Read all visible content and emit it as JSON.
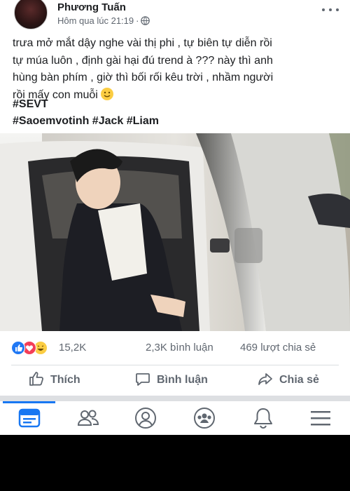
{
  "post": {
    "author": "Phương Tuấn",
    "time": "Hôm qua lúc 21:19",
    "dot": "·",
    "text_lines": [
      "trưa mở mắt dậy nghe vài thị phi , tự biên tự diễn rồi",
      "tự múa luôn , định gài hại đú trend à ??? này thì anh",
      "hùng bàn phím , giờ thì bối rối kêu trời , nhầm người",
      "rồi mấy con muỗi"
    ],
    "emoji": "🙂",
    "hashtag_lines": [
      "#SEVT",
      "#Saoemvotinh #Jack #Liam"
    ]
  },
  "stats": {
    "reactions_count": "15,2K",
    "comments": "2,3K bình luận",
    "shares": "469 lượt chia sẻ"
  },
  "actions": {
    "like": "Thích",
    "comment": "Bình luận",
    "share": "Chia sẻ"
  },
  "colors": {
    "accent": "#1877f2",
    "text": "#1c1e21",
    "muted": "#606770",
    "like_blue": "#2078f4",
    "love_red": "#f33e58",
    "haha_yellow": "#fbcd43"
  },
  "nav": {
    "items": [
      "news-feed-icon",
      "friends-icon",
      "profile-icon",
      "groups-icon",
      "notifications-icon",
      "menu-icon"
    ],
    "active": "news-feed-icon"
  }
}
